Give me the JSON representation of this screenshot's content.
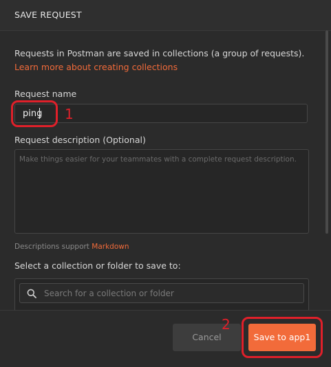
{
  "dialog": {
    "title": "SAVE REQUEST",
    "info_text": "Requests in Postman are saved in collections (a group of requests).",
    "learn_more_link": "Learn more about creating collections"
  },
  "request_name": {
    "label": "Request name",
    "value": "ping"
  },
  "request_description": {
    "label": "Request description (Optional)",
    "placeholder": "Make things easier for your teammates with a complete request description.",
    "support_text": "Descriptions support",
    "support_link": "Markdown"
  },
  "collection": {
    "label": "Select a collection or folder to save to:",
    "search_placeholder": "Search for a collection or folder",
    "search_icon": "search-icon"
  },
  "footer": {
    "cancel_label": "Cancel",
    "save_label": "Save to app1"
  },
  "annotations": {
    "step1": "1",
    "step2": "2",
    "color": "#e0202a"
  },
  "colors": {
    "accent": "#f26b3a",
    "background": "#2b2b2b"
  }
}
